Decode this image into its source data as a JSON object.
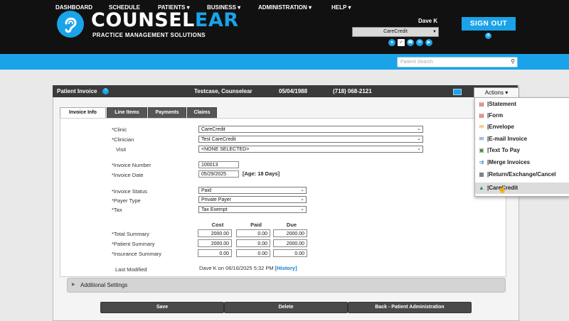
{
  "brand": {
    "name_main": "COUNSEL",
    "name_accent": "EAR",
    "tagline": "PRACTICE MANAGEMENT SOLUTIONS",
    "accent_color": "#1aa3e8"
  },
  "user": {
    "name": "Dave K",
    "location": "CareCredit",
    "sign_out": "SIGN OUT"
  },
  "header_icons": [
    "chat-icon",
    "check-icon",
    "phone-icon",
    "message-icon",
    "play-icon"
  ],
  "nav": {
    "items": [
      "DASHBOARD",
      "SCHEDULE",
      "PATIENTS",
      "BUSINESS",
      "ADMINISTRATION",
      "HELP"
    ],
    "search_placeholder": "Patient Search"
  },
  "invoice": {
    "title": "Patient Invoice",
    "patient_name": "Testcase, Counselear",
    "dob": "05/04/1988",
    "phone": "(718) 068-2121",
    "actions_label": "Actions",
    "tabs": [
      "Invoice Info",
      "Line Items",
      "Payments",
      "Claims"
    ],
    "fields": {
      "clinic_label": "*Clinic",
      "clinic_value": "CareCredit",
      "clinician_label": "*Clinician",
      "clinician_value": "Test CareCredit",
      "visit_label": "Visit",
      "visit_value": "<NONE SELECTED>",
      "invoice_number_label": "*Invoice Number",
      "invoice_number_value": "100013",
      "invoice_date_label": "*Invoice Date",
      "invoice_date_value": "05/29/2025",
      "age": "[Age: 18 Days]",
      "status_label": "*Invoice Status",
      "status_value": "Paid",
      "payer_label": "*Payer Type",
      "payer_value": "Private Payer",
      "tax_label": "*Tax",
      "tax_value": "Tax Exempt"
    },
    "summary": {
      "columns": [
        "Cost",
        "Paid",
        "Due"
      ],
      "rows": [
        {
          "label": "*Total Summary",
          "cost": "2000.00",
          "paid": "0.00",
          "due": "2000.00"
        },
        {
          "label": "*Patient Summary",
          "cost": "2000.00",
          "paid": "0.00",
          "due": "2000.00"
        },
        {
          "label": "*Insurance Summary",
          "cost": "0.00",
          "paid": "0.00",
          "due": "0.00"
        }
      ]
    },
    "last_modified_label": "Last Modified",
    "last_modified_value": "Dave K on 06/16/2025 5:32 PM",
    "history_link": "[History]",
    "additional_settings": "Additional Settings",
    "buttons": {
      "save": "Save",
      "delete": "Delete",
      "back": "Back - Patient Administration"
    }
  },
  "actions_menu": [
    {
      "label": "|Statement",
      "icon": "pdf-icon"
    },
    {
      "label": "|Form",
      "icon": "pdf-icon"
    },
    {
      "label": "|Envelope",
      "icon": "envelope-icon"
    },
    {
      "label": "|E-mail Invoice",
      "icon": "email-icon"
    },
    {
      "label": "|Text To Pay",
      "icon": "text-icon"
    },
    {
      "label": "|Merge Invoices",
      "icon": "merge-icon"
    },
    {
      "label": "|Return/Exchange/Cancel",
      "icon": "return-icon"
    },
    {
      "label": "|CareCredit",
      "icon": "carecredit-icon",
      "highlighted": true
    }
  ]
}
